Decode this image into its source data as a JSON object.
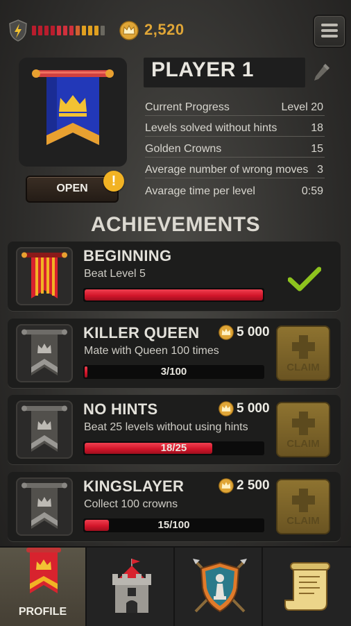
{
  "topbar": {
    "energy_colors": [
      "#b81d2d",
      "#b81d2d",
      "#b81d2d",
      "#b81d2d",
      "#d0303c",
      "#d0303c",
      "#d0303c",
      "#d06030",
      "#e0a020",
      "#e0a020",
      "#e0a020",
      "#6a6860"
    ],
    "coins": "2,520",
    "coin_icon": "crown-coin-icon",
    "menu_icon": "hamburger-menu-icon"
  },
  "profile": {
    "name": "PLAYER 1",
    "open_label": "OPEN",
    "alert": "!",
    "stats": [
      {
        "label": "Current Progress",
        "value": "Level 20"
      },
      {
        "label": "Levels solved without hints",
        "value": "18"
      },
      {
        "label": "Golden Crowns",
        "value": "15"
      },
      {
        "label": "Average number of wrong moves",
        "value": "3"
      },
      {
        "label": "Avarage time per level",
        "value": "0:59"
      }
    ]
  },
  "achievements": {
    "title": "ACHIEVEMENTS",
    "items": [
      {
        "title": "BEGINNING",
        "desc": "Beat Level 5",
        "progress": 1.0,
        "progress_text": "",
        "reward": "",
        "claim": "",
        "completed": true
      },
      {
        "title": "KILLER QUEEN",
        "desc": "Mate with Queen 100 times",
        "progress": 0.03,
        "progress_text": "3/100",
        "reward": "5 000",
        "claim": "CLAIM",
        "completed": false
      },
      {
        "title": "NO HINTS",
        "desc": "Beat 25 levels without using hints",
        "progress": 0.72,
        "progress_text": "18/25",
        "reward": "5 000",
        "claim": "CLAIM",
        "completed": false
      },
      {
        "title": "KINGSLAYER",
        "desc": "Collect 100 crowns",
        "progress": 0.15,
        "progress_text": "15/100",
        "reward": "2 500",
        "claim": "CLAIM",
        "completed": false
      }
    ]
  },
  "nav": {
    "tabs": [
      {
        "label": "PROFILE",
        "icon": "banner-crown-icon",
        "active": true
      },
      {
        "label": "",
        "icon": "castle-tower-icon",
        "active": false
      },
      {
        "label": "",
        "icon": "shield-pawn-icon",
        "active": false
      },
      {
        "label": "",
        "icon": "scroll-map-icon",
        "active": false
      }
    ]
  }
}
